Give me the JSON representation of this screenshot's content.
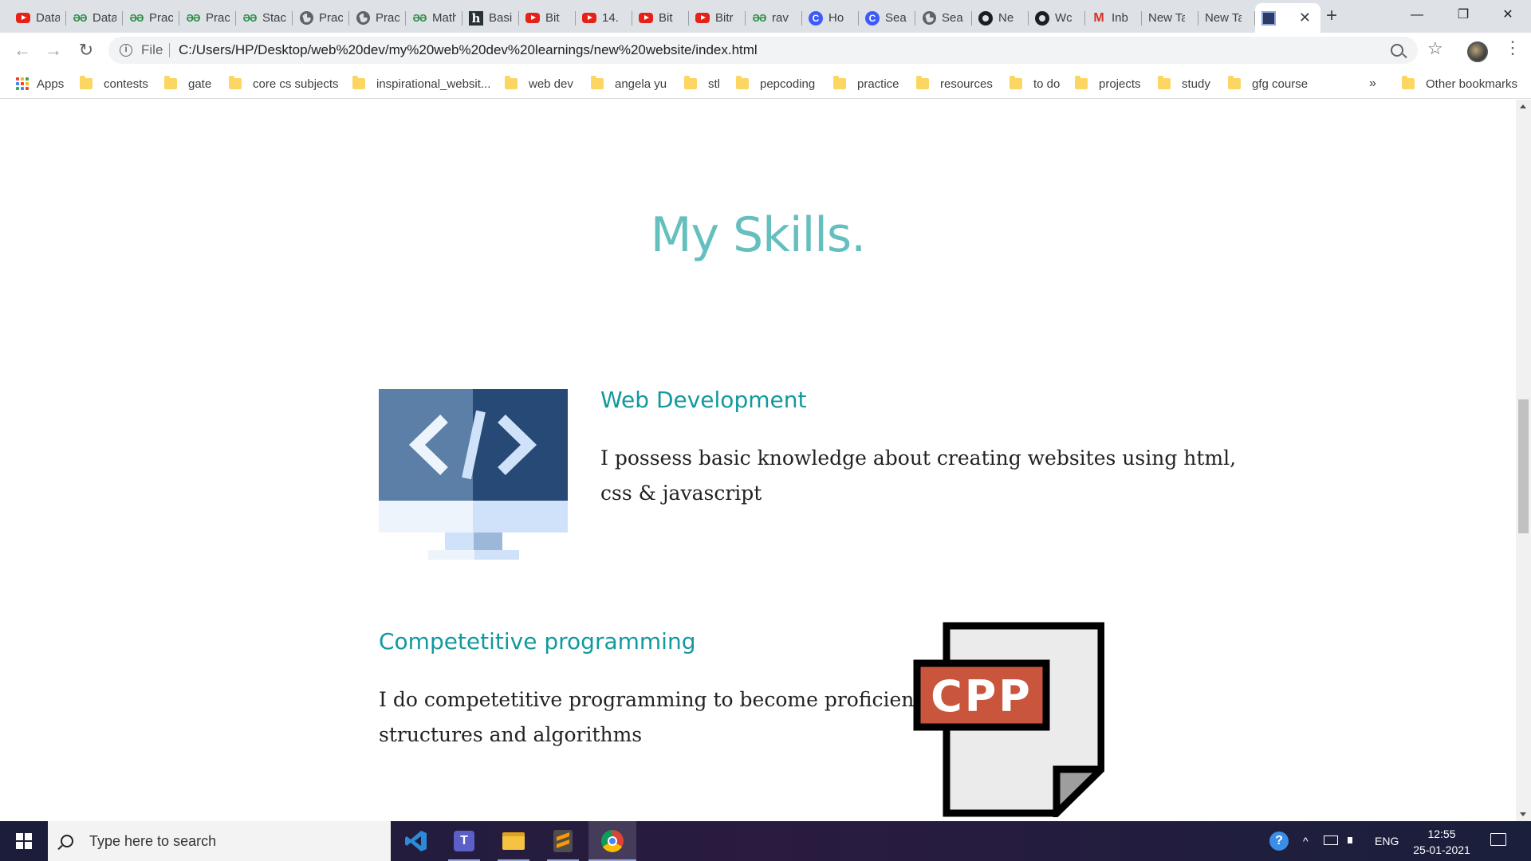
{
  "tabs": [
    {
      "label": "Data",
      "icon": "youtube"
    },
    {
      "label": "Data",
      "icon": "gfg"
    },
    {
      "label": "Prac",
      "icon": "gfg"
    },
    {
      "label": "Prac",
      "icon": "gfg"
    },
    {
      "label": "Stac",
      "icon": "gfg"
    },
    {
      "label": "Prac",
      "icon": "globe"
    },
    {
      "label": "Prac",
      "icon": "globe"
    },
    {
      "label": "Math",
      "icon": "gfg"
    },
    {
      "label": "Basi",
      "icon": "hackerrank"
    },
    {
      "label": "Bit",
      "icon": "youtube"
    },
    {
      "label": "14.",
      "icon": "youtube"
    },
    {
      "label": "Bit",
      "icon": "youtube"
    },
    {
      "label": "Bitr",
      "icon": "youtube"
    },
    {
      "label": "rav",
      "icon": "gfg"
    },
    {
      "label": "Ho",
      "icon": "codechef"
    },
    {
      "label": "Sea",
      "icon": "codechef"
    },
    {
      "label": "Sea",
      "icon": "globe"
    },
    {
      "label": "Ne",
      "icon": "github"
    },
    {
      "label": "Wc",
      "icon": "github"
    },
    {
      "label": "Inb",
      "icon": "gmail"
    },
    {
      "label": "New Ta",
      "icon": "none"
    },
    {
      "label": "New Ta",
      "icon": "none"
    }
  ],
  "active_tab": {
    "icon": "site-favicon",
    "close": "✕"
  },
  "new_tab_label": "+",
  "window_controls": {
    "minimize": "—",
    "maximize": "❐",
    "close": "✕"
  },
  "toolbar": {
    "back": "←",
    "forward": "→",
    "reload": "↻",
    "info": "i",
    "file_label": "File",
    "url": "C:/Users/HP/Desktop/web%20dev/my%20web%20dev%20learnings/new%20website/index.html",
    "star": "☆",
    "menu": "⋮"
  },
  "bookmarks": {
    "apps_label": "Apps",
    "folders": [
      "contests",
      "gate",
      "core cs subjects",
      "inspirational_websit...",
      "web dev",
      "angela yu",
      "stl",
      "pepcoding",
      "practice",
      "resources",
      "to do",
      "projects",
      "study",
      "gfg course"
    ],
    "overflow": "»",
    "other": "Other bookmarks"
  },
  "page": {
    "title": "My Skills.",
    "skills": [
      {
        "heading": "Web Development",
        "text_line1": "I possess basic knowledge about creating websites using html,",
        "text_line2": "css & javascript",
        "image_label": "</>"
      },
      {
        "heading": "Competetitive programming",
        "text_line1": "I do competetitive programming to become proficient at data",
        "text_line2": "structures and algorithms",
        "image_label": "CPP"
      }
    ]
  },
  "taskbar": {
    "search_placeholder": "Type here to search",
    "apps": [
      "vscode",
      "teams",
      "file-explorer",
      "sublime-text",
      "chrome"
    ],
    "tray": {
      "chevron": "^",
      "language": "ENG",
      "time": "12:55",
      "date": "25-01-2021"
    }
  },
  "colors": {
    "title": "#66bfbf",
    "heading": "#11999e",
    "cpp_badge": "#c9553d"
  }
}
